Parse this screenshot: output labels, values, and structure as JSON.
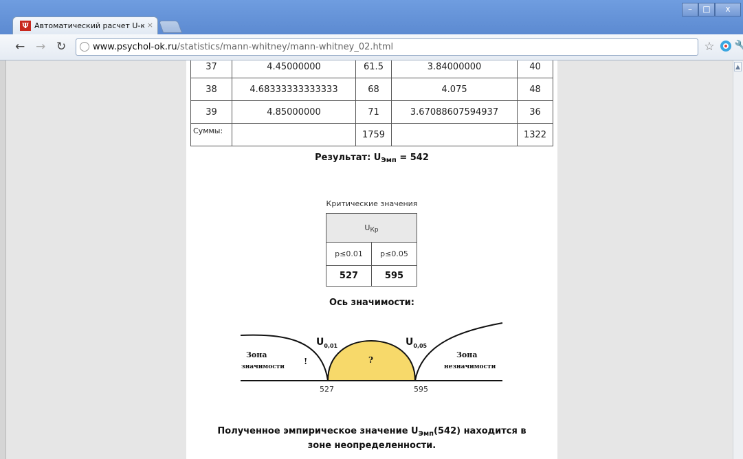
{
  "browser": {
    "tab_title": "Автоматический расчет U-кр",
    "tab_close": "×",
    "url_host": "www.psychol-ok.ru",
    "url_path": "/statistics/mann-whitney/mann-whitney_02.html",
    "icons": [
      "back-arrow-icon",
      "forward-arrow-icon",
      "reload-icon",
      "globe-icon",
      "star-icon",
      "skype-icon",
      "wrench-icon"
    ]
  },
  "table": {
    "rows": [
      [
        "37",
        "4.45000000",
        "61.5",
        "3.84000000",
        "40"
      ],
      [
        "38",
        "4.68333333333333",
        "68",
        "4.075",
        "48"
      ],
      [
        "39",
        "4.85000000",
        "71",
        "3.67088607594937",
        "36"
      ]
    ],
    "sums_label": "Суммы:",
    "sum_rank1": "1759",
    "sum_rank2": "1322"
  },
  "result": {
    "label": "Результат: U",
    "subscript": "Эмп",
    "value": "= 542"
  },
  "critical": {
    "caption": "Критические значения",
    "header_main": "U",
    "header_sub": "Кр",
    "p1_label": "p≤0.01",
    "p2_label": "p≤0.05",
    "value1": "527",
    "value2": "595"
  },
  "axis": {
    "title": "Ось значимости:",
    "zone_left_1": "Зона",
    "zone_left_2": "значимости",
    "zone_right_1": "Зона",
    "zone_right_2": "незначимости",
    "u1_main": "U",
    "u1_sub": "0,01",
    "u2_main": "U",
    "u2_sub": "0,05",
    "mark_left": "!",
    "mark_center": "?",
    "tick_left": "527",
    "tick_right": "595",
    "fill_color": "#f7d96a"
  },
  "conclusion": {
    "part1": "Полученное эмпирическое значение U",
    "subscript": "Эмп",
    "part2": "(542) находится в",
    "line2": "зоне неопределенности."
  }
}
